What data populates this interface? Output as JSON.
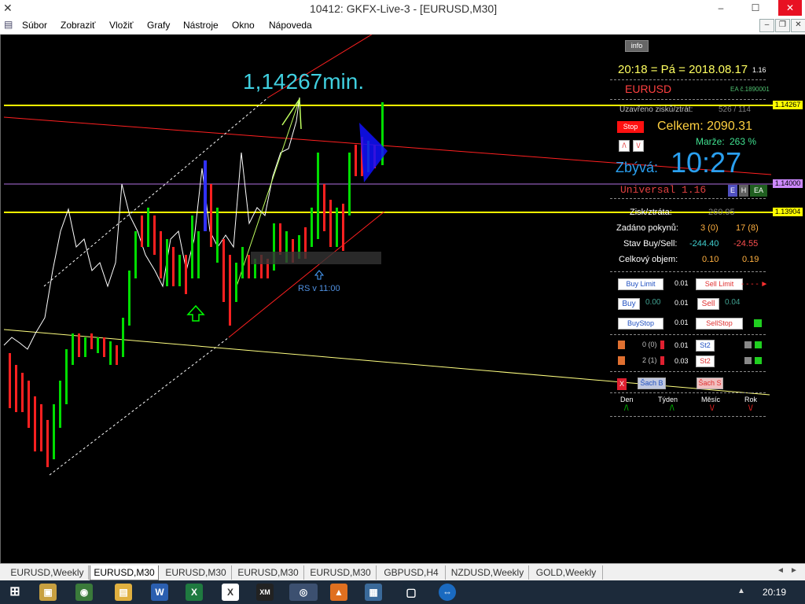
{
  "window": {
    "title": "10412: GKFX-Live-3 - [EURUSD,M30]",
    "minimize": "‒",
    "maximize": "☐",
    "close": "✕"
  },
  "menu": [
    "Súbor",
    "Zobraziť",
    "Vložiť",
    "Grafy",
    "Nástroje",
    "Okno",
    "Nápoveda"
  ],
  "mdi": {
    "min": "–",
    "restore": "❐",
    "close": "✕"
  },
  "chart": {
    "annotation_big": "1,14267min.",
    "rs_label": "RS v 11:00",
    "price_levels": [
      {
        "label": "1.14267",
        "color": "#ffff00"
      },
      {
        "label": "1.14000",
        "color": "#cc88ff"
      },
      {
        "label": "1.13904",
        "color": "#ffff00"
      }
    ]
  },
  "panel": {
    "info_btn": "info",
    "datetime": "20:18 = Pá = 2018.08.17",
    "datetime_small": "1.16",
    "symbol": "EURUSD",
    "ea_no": "EA č.1890001",
    "closed_label": "Uzavřeno zisků/ztrát:",
    "closed_value": "526 / 114",
    "stop_btn": "Stop",
    "total_label": "Celkem: 2090.31",
    "up_btn": "/\\",
    "down_btn": "\\/",
    "margin_label": "Marže:",
    "margin_value": "263 %",
    "remaining_label": "Zbývá:",
    "remaining_time": "10:27",
    "universal": "Universal 1.16",
    "badges": [
      "E",
      "H",
      "EA"
    ],
    "profit_label": "Zisk/ztráta:",
    "profit_value": "260.95",
    "orders_label": "Zadáno pokynů:",
    "orders_buy": "3 (0)",
    "orders_sell": "17 (8)",
    "state_label": "Stav Buy/Sell:",
    "state_buy": "-244.40",
    "state_sell": "-24.55",
    "volume_label": "Celkový objem:",
    "volume_buy": "0.10",
    "volume_sell": "0.19",
    "buy_limit_btn": "Buy Limit",
    "buy_limit_lot": "0.01",
    "sell_limit_btn": "Sell Limit",
    "buy_btn": "Buy",
    "buy_price": "0.00",
    "lot_mid": "0.01",
    "sell_btn": "Sell",
    "sell_price": "0.04",
    "buy_stop_btn": "BuyStop",
    "buy_stop_lot": "0.01",
    "sell_stop_btn": "SellStop",
    "row1_count": "0 (0)",
    "row1_lot": "0.01",
    "row1_btn": "St2",
    "row2_count": "2 (1)",
    "row2_lot": "0.03",
    "row2_btn": "St2",
    "x_btn": "X",
    "sach_b": "Šach B",
    "sach_s": "Šach S",
    "periods": [
      {
        "label": "Den",
        "arrow": "/\\",
        "color": "#00cc00"
      },
      {
        "label": "Týden",
        "arrow": "/\\",
        "color": "#00cc00"
      },
      {
        "label": "Měsíc",
        "arrow": "\\/",
        "color": "#ff2222"
      },
      {
        "label": "Rok",
        "arrow": "\\/",
        "color": "#ff2222"
      }
    ]
  },
  "tabs": [
    "EURUSD,Weekly",
    "EURUSD,M30",
    "EURUSD,M30",
    "EURUSD,M30",
    "EURUSD,M30",
    "GBPUSD,H4",
    "NZDUSD,Weekly",
    "GOLD,Weekly"
  ],
  "active_tab": 1,
  "taskbar": {
    "clock": "20:19",
    "apps": [
      {
        "icon": "start-icon",
        "glyph": "⊞",
        "color": "#1c2a3a"
      },
      {
        "icon": "folder-icon",
        "glyph": "▣",
        "color": "#c8a040"
      },
      {
        "icon": "earth-icon",
        "glyph": "◉",
        "color": "#3a7a3a"
      },
      {
        "icon": "explorer-icon",
        "glyph": "▤",
        "color": "#e0b040"
      },
      {
        "icon": "word-icon",
        "glyph": "W",
        "color": "#2b5fb0"
      },
      {
        "icon": "excel-icon",
        "glyph": "X",
        "color": "#1f7a40"
      },
      {
        "icon": "terminal-icon",
        "glyph": "X",
        "color": "#ffffff"
      },
      {
        "icon": "xm-icon",
        "glyph": "XM",
        "color": "#222222"
      },
      {
        "icon": "chrome-icon",
        "glyph": "◎",
        "color": "#4a80d0"
      },
      {
        "icon": "vlc-icon",
        "glyph": "▲",
        "color": "#e07020"
      },
      {
        "icon": "photos-icon",
        "glyph": "▦",
        "color": "#3a6a9a"
      },
      {
        "icon": "teamviewer-icon",
        "glyph": "⇔",
        "color": "#1a6ac0"
      }
    ]
  }
}
